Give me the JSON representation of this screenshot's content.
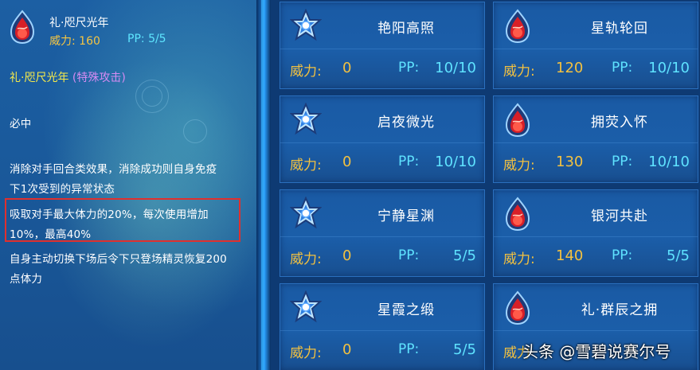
{
  "selected_skill": {
    "name": "礼·咫尺光年",
    "power_label": "威力:",
    "power_value": "160",
    "pp_label": "PP:",
    "pp_value": "5/5",
    "icon": "red-flame-icon",
    "type_name": "礼·咫尺光年",
    "type_category": "(特殊攻击)",
    "description": [
      "必中",
      "消除对手回合类效果，消除成功则自身免疫",
      "下1次受到的异常状态",
      "吸取对手最大体力的20%，每次使用增加",
      "10%，最高40%",
      "自身主动切换下场后令下只登场精灵恢复200",
      "点体力"
    ],
    "highlight_color": "#e0302e"
  },
  "skills": [
    {
      "name": "艳阳高照",
      "icon": "blue-star-icon",
      "power_label": "威力:",
      "power": "0",
      "pp_label": "PP:",
      "pp": "10/10"
    },
    {
      "name": "星轨轮回",
      "icon": "red-flame-icon",
      "power_label": "威力:",
      "power": "120",
      "pp_label": "PP:",
      "pp": "10/10"
    },
    {
      "name": "启夜微光",
      "icon": "blue-star-icon",
      "power_label": "威力:",
      "power": "0",
      "pp_label": "PP:",
      "pp": "10/10"
    },
    {
      "name": "拥荧入怀",
      "icon": "red-flame-icon",
      "power_label": "威力:",
      "power": "130",
      "pp_label": "PP:",
      "pp": "10/10"
    },
    {
      "name": "宁静星渊",
      "icon": "blue-star-icon",
      "power_label": "威力:",
      "power": "0",
      "pp_label": "PP:",
      "pp": "5/5"
    },
    {
      "name": "银河共赴",
      "icon": "red-flame-icon",
      "power_label": "威力:",
      "power": "140",
      "pp_label": "PP:",
      "pp": "5/5"
    },
    {
      "name": "星霞之缎",
      "icon": "blue-star-icon",
      "power_label": "威力:",
      "power": "0",
      "pp_label": "PP:",
      "pp": "5/5"
    },
    {
      "name": "礼·群辰之拥",
      "icon": "red-flame-icon",
      "power_label": "威力",
      "power": "",
      "pp_label": "",
      "pp": ""
    }
  ],
  "watermark": "头条 @雪碧说赛尔号",
  "colors": {
    "power": "#f3c140",
    "pp": "#5fe3ff",
    "skill_name_highlight": "#f6ea4a",
    "category": "#d58bf2"
  }
}
